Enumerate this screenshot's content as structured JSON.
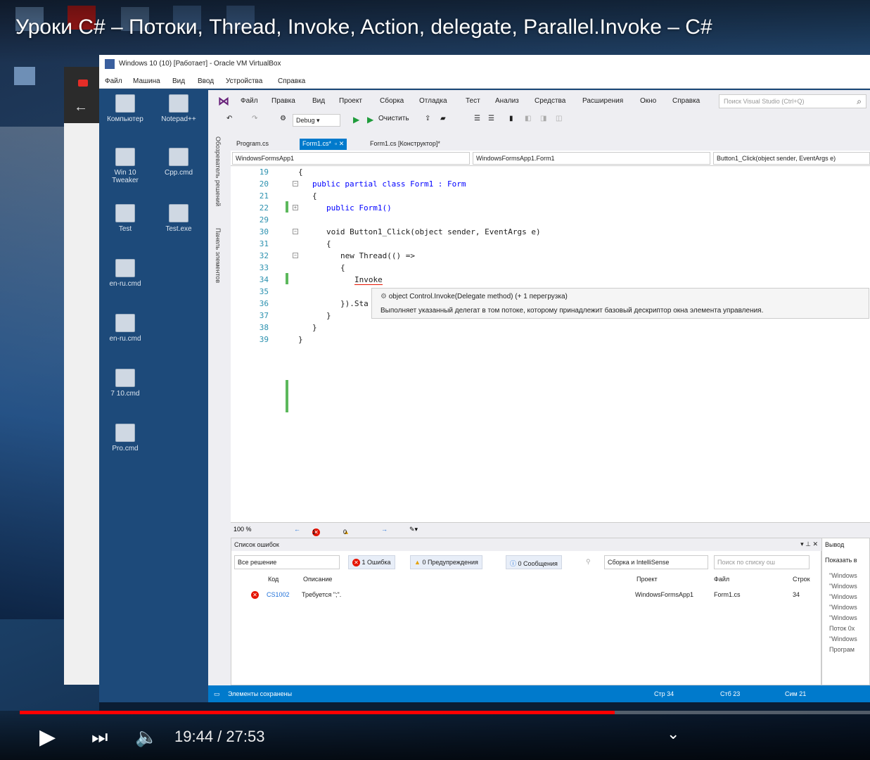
{
  "video": {
    "title": "Уроки C# – Потоки, Thread, Invoke, Action, delegate, Parallel.Invoke – C#",
    "current_time": "19:44",
    "separator": " / ",
    "duration": "27:53",
    "progress": 0.7
  },
  "vm": {
    "title": "Windows 10 (10) [Работает] - Oracle VM VirtualBox",
    "menu": [
      "Файл",
      "Машина",
      "Вид",
      "Ввод",
      "Устройства",
      "Справка"
    ]
  },
  "guest_desktop": {
    "icons": [
      "Компьютер",
      "Notepad++",
      "Win 10 Tweaker",
      "Сpp.cmd",
      "Test",
      "Test.exe",
      "en-ru.cmd",
      "en-ru.cmd",
      "7 10.cmd",
      "Pro.cmd"
    ]
  },
  "vs": {
    "menu": [
      "Файл",
      "Правка",
      "Вид",
      "Проект",
      "Сборка",
      "Отладка",
      "Тест",
      "Анализ",
      "Средства",
      "Расширения",
      "Окно",
      "Справка"
    ],
    "search_placeholder": "Поиск Visual Studio (Ctrl+Q)",
    "config": "Debug",
    "run_label": "Очистить",
    "side_labels": [
      "Обозреватель решений",
      "Панель элементов"
    ],
    "tabs": [
      "Program.cs",
      "Form1.cs*",
      "Form1.cs [Конструктор]*"
    ],
    "nav": [
      "WindowsFormsApp1",
      "WindowsFormsApp1.Form1",
      "Button1_Click(object sender, EventArgs e)"
    ],
    "code_lines": [
      {
        "n": "19",
        "text": "{"
      },
      {
        "n": "20",
        "text": "public partial class Form1 : Form"
      },
      {
        "n": "21",
        "text": "{"
      },
      {
        "n": "22",
        "text": "public Form1()"
      },
      {
        "n": "29",
        "text": ""
      },
      {
        "n": "30",
        "text": "void Button1_Click(object sender, EventArgs e)"
      },
      {
        "n": "31",
        "text": "{"
      },
      {
        "n": "32",
        "text": "new Thread(() =>"
      },
      {
        "n": "33",
        "text": "{"
      },
      {
        "n": "34",
        "text": "Invoke"
      },
      {
        "n": "35",
        "text": ""
      },
      {
        "n": "36",
        "text": "}).Sta"
      },
      {
        "n": "37",
        "text": "}"
      },
      {
        "n": "38",
        "text": "}"
      },
      {
        "n": "39",
        "text": "}"
      }
    ],
    "tooltip": {
      "signature": "object Control.Invoke(Delegate method) (+ 1 перегрузка)",
      "description": "Выполняет указанный делегат в том потоке, которому принадлежит базовый дескриптор окна элемента управления."
    },
    "editor_status": {
      "zoom": "100 %",
      "errors": "1",
      "warnings": "0"
    },
    "errors_panel": {
      "title": "Список ошибок",
      "scope": "Все решение",
      "btn_errors": "1 Ошибка",
      "btn_warnings": "0 Предупреждения",
      "btn_messages": "0 Сообщения",
      "build_filter": "Сборка и IntelliSense",
      "search_placeholder": "Поиск по списку ош",
      "columns": [
        "Код",
        "Описание",
        "Проект",
        "Файл",
        "Строк"
      ],
      "row": {
        "code": "CS1002",
        "description": "Требуется \";\".",
        "project": "WindowsFormsApp1",
        "file": "Form1.cs",
        "line": "34"
      }
    },
    "output_panel": {
      "title": "Вывод",
      "show_label": "Показать в",
      "lines": [
        "\"Windows",
        "\"Windows",
        "\"Windows",
        "\"Windows",
        "\"Windows",
        "Поток 0x",
        "\"Windows",
        "Програм"
      ]
    },
    "statusbar": {
      "message": "Элементы сохранены",
      "line": "Стр 34",
      "col": "Стб 23",
      "char": "Сим 21"
    }
  }
}
